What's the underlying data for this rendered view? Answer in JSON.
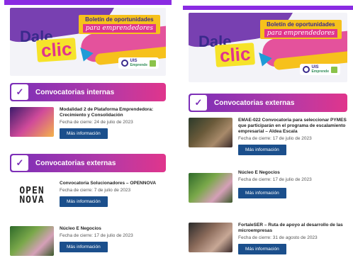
{
  "banner": {
    "dale": "Dale",
    "clic": "clic",
    "tag_line1": "Boletín de oportunidades",
    "tag_line2": "para emprendedores",
    "logo_name": "UIS",
    "logo_sub": "Emprende"
  },
  "left": {
    "internas_title": "Convocatorias internas",
    "internas": [
      {
        "title": "Modalidad 2 de Plataforma Emprendedora: Crecimiento y Consolidación",
        "date": "Fecha de cierre: 24 de julio de 2023",
        "button": "Más información"
      }
    ],
    "externas_title": "Convocatorias externas",
    "externas": [
      {
        "title": "Convocatoria Solucionadores – OPENNOVA",
        "date": "Fecha de cierre: 7 de julio de 2023",
        "button": "Más información",
        "logo_line1": "OPEN",
        "logo_line2": "NOVA"
      },
      {
        "title": "Núcleo E Negocios",
        "date": "Fecha de cierre: 17 de julio de 2023",
        "button": "Más información"
      }
    ]
  },
  "right": {
    "externas_title": "Convocatorias externas",
    "externas": [
      {
        "title": "EMAE-022 Convocatoria para seleccionar PYMES que participarán en el programa de escalamiento empresarial – Aldea Escala",
        "date": "Fecha de cierre: 17 de julio de 2023",
        "button": "Más información"
      },
      {
        "title": "Núcleo E Negocios",
        "date": "Fecha de cierre: 17 de julio de 2023",
        "button": "Más información"
      },
      {
        "title": "FortaleSER – Ruta de apoyo al desarrollo de las microempresas",
        "date": "Fecha de cierre: 31 de agosto de 2023",
        "button": "Más información"
      }
    ]
  },
  "colors": {
    "purple": "#7b2fb8",
    "magenta": "#e0358c",
    "yellow": "#f6c11c",
    "button_blue": "#1b4f8c"
  },
  "icons": {
    "section": "checkmark-icon",
    "cursor": "cursor-arrow-icon"
  }
}
